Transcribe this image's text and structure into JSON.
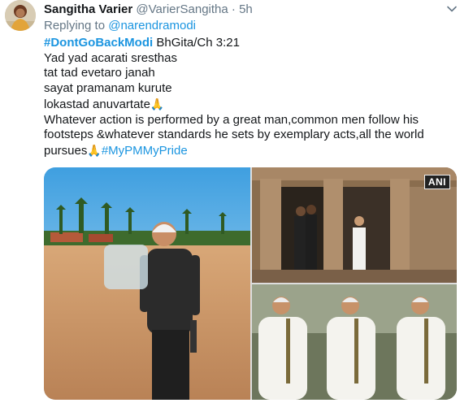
{
  "author": {
    "name": "Sangitha Varier",
    "handle": "@VarierSangitha",
    "separator": "·",
    "time": "5h"
  },
  "reply": {
    "prefix": "Replying to ",
    "mention": "@narendramodi"
  },
  "body": {
    "line1_hashtag": "#DontGoBackModi",
    "line1_rest": " BhGita/Ch 3:21",
    "line2": "Yad yad acarati sresthas",
    "line3": "tat tad evetaro janah",
    "line4": "sayat pramanam kurute",
    "line5": "lokastad anuvartate",
    "emoji": "🙏",
    "line6": "Whatever action is performed by a great man,common men follow his",
    "line7": "footsteps &whatever standards he sets by exemplary acts,all the world",
    "line8_text": "pursues",
    "line8_hashtag": "#MyPMMyPride"
  },
  "media": {
    "badge": "ANI"
  },
  "icons": {
    "menu": "chevron-down-icon"
  },
  "colors": {
    "link": "#1b95e0",
    "secondary": "#657786"
  }
}
